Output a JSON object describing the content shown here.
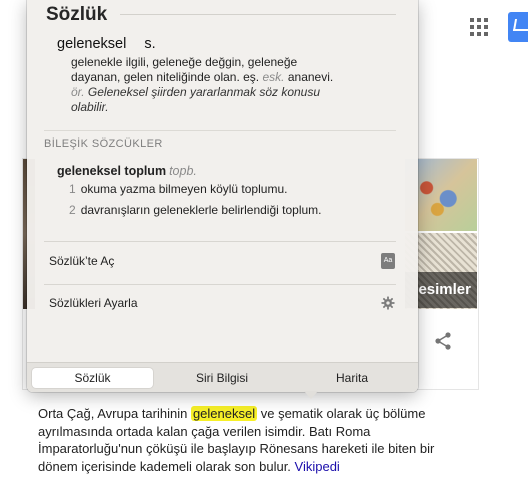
{
  "popover": {
    "title": "Sözlük",
    "entry": {
      "headword": "geleneksel",
      "pos": "s.",
      "definition_1": "gelenekle ilgili, geleneğe değgin, geleneğe",
      "definition_2a": "dayanan, gelen niteliğinde olan. eş.",
      "definition_abbr": "esk.",
      "definition_2b": "ananevi.",
      "example_abbr": "ör.",
      "example_1": "Geleneksel şiirden yararlanmak söz konusu",
      "example_2": "olabilir."
    },
    "compound_section_title": "BİLEŞİK SÖZCÜKLER",
    "compound": {
      "word": "geleneksel toplum",
      "tag": "topb.",
      "senses": [
        {
          "num": "1",
          "text": "okuma yazma bilmeyen köylü toplumu."
        },
        {
          "num": "2",
          "text": "davranışların geleneklerle belirlendiği toplum."
        }
      ]
    },
    "menu": {
      "open_dictionary": "Sözlük’te Aç",
      "book_icon_text": "Aa",
      "dictionary_settings": "Sözlükleri Ayarla"
    },
    "tabs": [
      "Sözlük",
      "Siri Bilgisi",
      "Harita"
    ]
  },
  "background": {
    "images_label": "esimler",
    "description_part1": "Orta Çağ, Avrupa tarihinin ",
    "description_highlight": "geleneksel",
    "description_part2": " ve şematik olarak üç bölüme ayrılmasında ortada kalan çağa verilen isimdir. Batı Roma İmparatorluğu'nun çöküşü ile başlayıp Rönesans hareketi ile biten bir dönem içerisinde kademeli olarak son bulur. ",
    "source_link": "Vikipedi"
  },
  "colors": {
    "highlight": "#f7f028",
    "link": "#1a0dab",
    "accent_blue": "#4285f4"
  }
}
